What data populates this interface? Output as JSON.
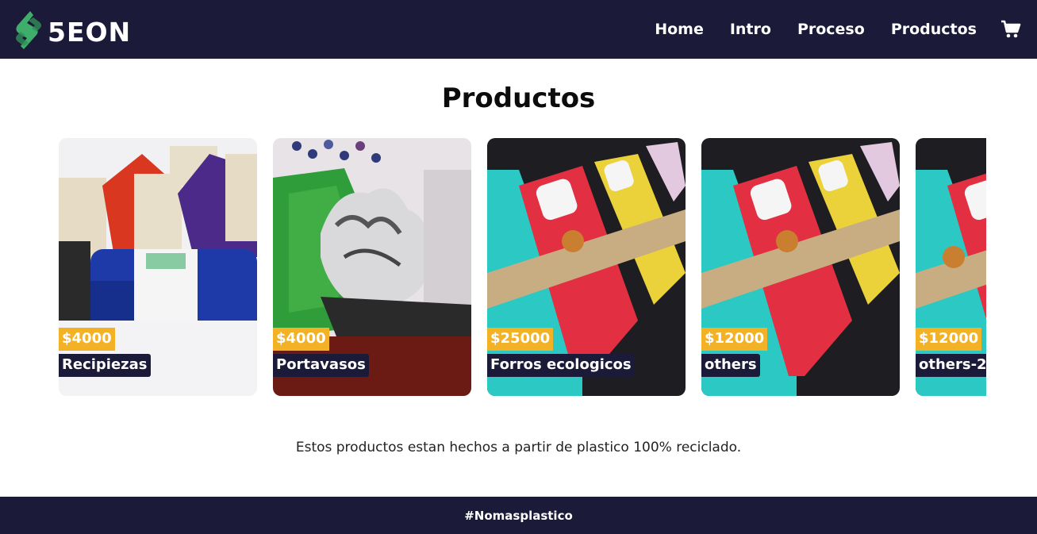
{
  "brand": {
    "name": "5EON",
    "logo_icon": "leaf-s-logo-icon",
    "colors": {
      "navy": "#1b1a38",
      "green": "#3fae6a",
      "gold": "#f3b125"
    }
  },
  "nav": {
    "items": [
      {
        "label": "Home"
      },
      {
        "label": "Intro"
      },
      {
        "label": "Proceso"
      },
      {
        "label": "Productos"
      }
    ],
    "cart_icon": "shopping-cart-icon"
  },
  "page": {
    "title": "Productos"
  },
  "products": [
    {
      "price": "$4000",
      "name": "Recipiezas"
    },
    {
      "price": "$4000",
      "name": "Portavasos"
    },
    {
      "price": "$25000",
      "name": "Forros ecologicos"
    },
    {
      "price": "$12000",
      "name": "others"
    },
    {
      "price": "$12000",
      "name": "others-2"
    }
  ],
  "description": "Estos productos estan hechos a partir de plastico 100% reciclado.",
  "footer": {
    "hashtag": "#Nomasplastico"
  }
}
